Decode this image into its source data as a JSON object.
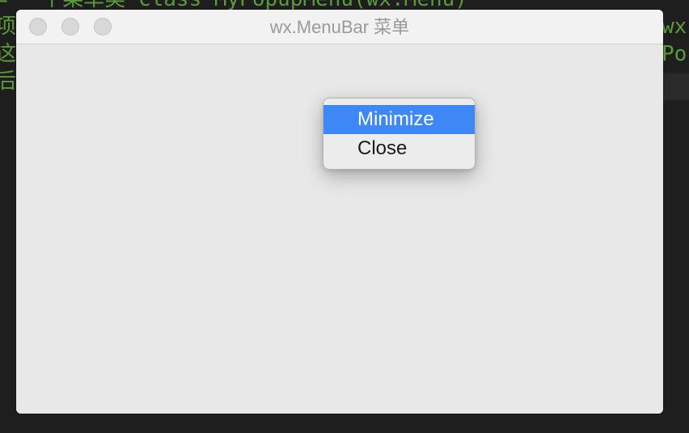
{
  "background": {
    "code_lines": [
      "= 一个菜单类 class MyPopupMenu(wx.Menu)",
      "项,",
      "这个",
      "后一"
    ],
    "right_fragments": [
      "wx.",
      "Po"
    ]
  },
  "window": {
    "title": "wx.MenuBar 菜单",
    "buttons": [
      "close",
      "minimize",
      "zoom"
    ]
  },
  "popup_menu": {
    "items": [
      {
        "label": "Minimize",
        "highlighted": true
      },
      {
        "label": "Close",
        "highlighted": false
      }
    ]
  },
  "colors": {
    "highlight": "#3d87f7",
    "code_text": "#5a9a3a"
  }
}
